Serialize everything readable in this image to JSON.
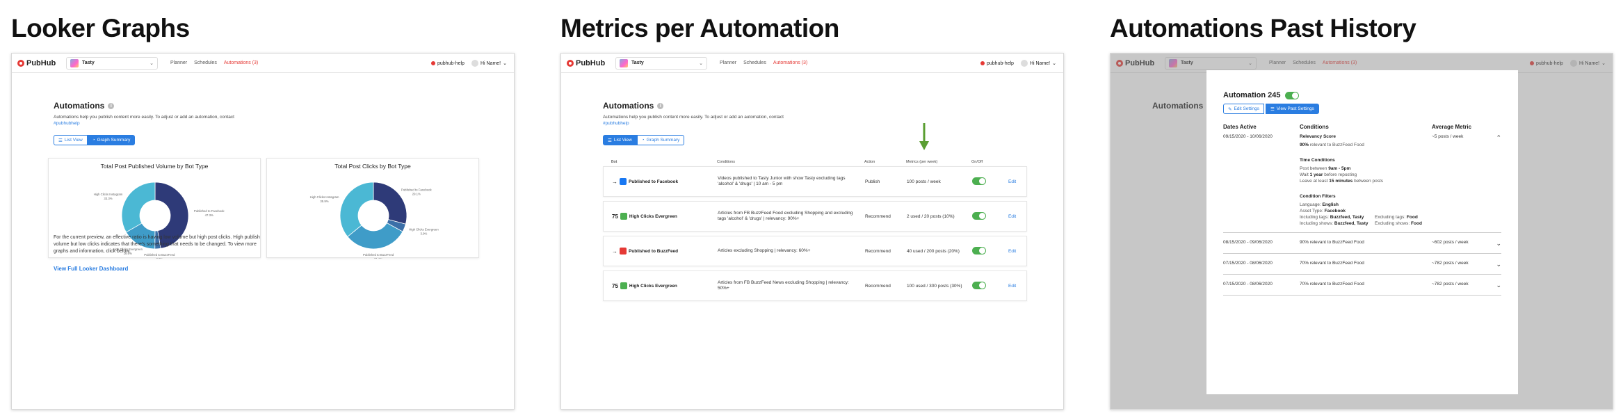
{
  "panels": [
    {
      "title": "Looker Graphs"
    },
    {
      "title": "Metrics per Automation"
    },
    {
      "title": "Automations Past History"
    }
  ],
  "app": {
    "logo": "PubHub",
    "brand": "Tasty",
    "nav": [
      "Planner",
      "Schedules",
      "Automations (3)"
    ],
    "help": "pubhub-help",
    "user": "Hi Name!"
  },
  "automations": {
    "heading": "Automations",
    "desc": "Automations help you publish content more easily. To adjust or add an automation, contact",
    "contact": "#pubhubhelp",
    "list_view": "List View",
    "graph_summary": "Graph Summary"
  },
  "graphs": {
    "chart_data": [
      {
        "type": "pie",
        "title": "Total Post Published Volume by Bot Type",
        "categories": [
          "Published to Facebook",
          "Published to BuzzFeed",
          "High Clicks Evergreen",
          "High Clicks Instagram"
        ],
        "values": [
          47.3,
          2.8,
          16.6,
          33.3
        ],
        "labels": [
          "Published to Facebook 47.3%",
          "Published to BuzzFeed 2.8%",
          "High Clicks Evergreen 16.6%",
          "High Clicks Instagram 33.3%"
        ]
      },
      {
        "type": "pie",
        "title": "Total Post Clicks by Bot Type",
        "categories": [
          "Published to Facebook",
          "High Clicks Evergreen",
          "Published to BuzzFeed",
          "High Clicks Instagram"
        ],
        "values": [
          29.1,
          3.9,
          31.1,
          35.9
        ],
        "labels": [
          "Published to Facebook 29.1%",
          "High Clicks Evergreen 3.9%",
          "Published to BuzzFeed 31.1%",
          "High Clicks Instagram 35.9%"
        ]
      }
    ],
    "note": "For the current preview, an effective ratio is having low volume but high post clicks. High publish volume but low clicks indicates that there's something that needs to be changed. To view more graphs and information, click below.",
    "link": "View Full Looker Dashboard"
  },
  "metrics": {
    "columns": [
      "Bot",
      "Conditions",
      "Action",
      "Metrics (per week)",
      "On/Off",
      ""
    ],
    "rows": [
      {
        "bot": "Published to Facebook",
        "cond": "Videos published to Tasty Junior with show Tasty excluding tags 'alcohol' & 'drugs' | 10 am - 5 pm",
        "action": "Publish",
        "metric": "100 posts / week",
        "edit": "Edit",
        "color": "#1877f2",
        "arrow": "→"
      },
      {
        "bot": "High Clicks Evergreen",
        "cond": "Articles from FB BuzzFeed Food excluding Shopping and excluding tags 'alcohol' & 'drugs' | relevancy: 90%+",
        "action": "Recommend",
        "metric": "2 used / 20 posts (10%)",
        "edit": "Edit",
        "color": "#4caf50",
        "arrow": "75"
      },
      {
        "bot": "Published to BuzzFeed",
        "cond": "Articles excluding Shopping | relevancy: 60%+",
        "action": "Recommend",
        "metric": "40 used / 200 posts (20%)",
        "edit": "Edit",
        "color": "#e53935",
        "arrow": "→"
      },
      {
        "bot": "High Clicks Evergreen",
        "cond": "Articles from FB BuzzFeed News excluding Shopping | relevancy: 50%+",
        "action": "Recommend",
        "metric": "100 used / 300 posts (30%)",
        "edit": "Edit",
        "color": "#4caf50",
        "arrow": "75"
      }
    ]
  },
  "history": {
    "title": "Automation 245",
    "edit_settings": "Edit Settings",
    "view_past": "View Past Settings",
    "headers": [
      "Dates Active",
      "Conditions",
      "Average Metric"
    ],
    "first": {
      "date": "09/15/2020 - 10/06/2020",
      "rel_title": "Relevancy Score",
      "rel_pct": "90%",
      "rel_text": "relevant to BuzzFeed Food",
      "metric": "~5 posts / week",
      "time_title": "Time Conditions",
      "t1a": "Post between",
      "t1b": "9am - 5pm",
      "t2a": "Wait",
      "t2b": "1 year",
      "t2c": "before reposting",
      "t3a": "Leave at least",
      "t3b": "15 minutes",
      "t3c": "between posts",
      "filter_title": "Condition Filters",
      "f1a": "Language:",
      "f1b": "English",
      "f2a": "Asset Type:",
      "f2b": "Facebook",
      "f3a": "Including tags:",
      "f3b": "Buzzfeed, Tasty",
      "f3c": "Excluding tags:",
      "f3d": "Food",
      "f4a": "Including shows:",
      "f4b": "Buzzfeed, Tasty",
      "f4c": "Excluding shows:",
      "f4d": "Food"
    },
    "rows": [
      {
        "date": "08/15/2020 - 09/06/2020",
        "cond": "90% relevant to BuzzFeed Food",
        "metric": "~602 posts / week"
      },
      {
        "date": "07/15/2020 - 08/06/2020",
        "cond": "70% relevant to BuzzFeed Food",
        "metric": "~782 posts / week"
      },
      {
        "date": "07/15/2020 - 08/06/2020",
        "cond": "70% relevant to BuzzFeed Food",
        "metric": "~782 posts / week"
      }
    ]
  },
  "colors": {
    "accent": "#2a7de1",
    "brand_red": "#e53935",
    "on": "#4caf50",
    "arrow": "#5a9e32"
  }
}
